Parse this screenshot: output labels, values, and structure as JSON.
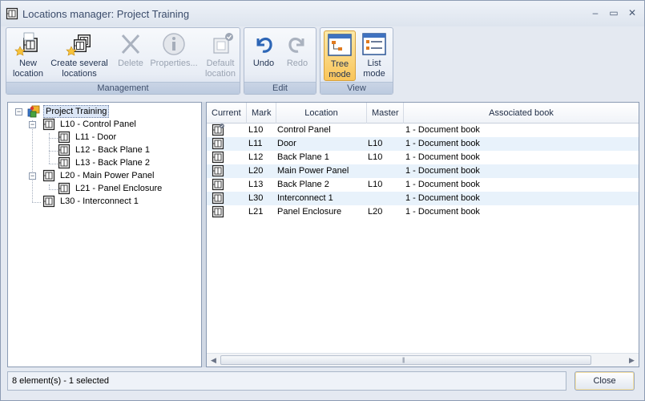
{
  "window": {
    "title": "Locations manager: Project Training",
    "minimize_glyph": "–",
    "maximize_glyph": "▭",
    "close_glyph": "✕"
  },
  "ribbon": {
    "groups": [
      {
        "label": "Management"
      },
      {
        "label": "Edit"
      },
      {
        "label": "View"
      }
    ],
    "buttons": {
      "new_location": {
        "line1": "New",
        "line2": "location",
        "icon": "new-location-icon"
      },
      "create_several": {
        "line1": "Create several",
        "line2": "locations",
        "icon": "create-several-locations-icon"
      },
      "delete": {
        "line1": "Delete",
        "icon": "delete-icon"
      },
      "properties": {
        "line1": "Properties...",
        "icon": "properties-icon"
      },
      "default_location": {
        "line1": "Default",
        "line2": "location",
        "icon": "default-location-icon"
      },
      "undo": {
        "line1": "Undo",
        "icon": "undo-icon"
      },
      "redo": {
        "line1": "Redo",
        "icon": "redo-icon"
      },
      "tree_mode": {
        "line1": "Tree",
        "line2": "mode",
        "icon": "tree-mode-icon"
      },
      "list_mode": {
        "line1": "List",
        "line2": "mode",
        "icon": "list-mode-icon"
      }
    }
  },
  "tree": {
    "root": "Project Training",
    "nodes": [
      {
        "label": "L10 - Control Panel"
      },
      {
        "label": "L11 - Door"
      },
      {
        "label": "L12 - Back Plane 1"
      },
      {
        "label": "L13 - Back Plane 2"
      },
      {
        "label": "L20 - Main Power Panel"
      },
      {
        "label": "L21 - Panel Enclosure"
      },
      {
        "label": "L30 - Interconnect 1"
      }
    ],
    "expander_open": "−"
  },
  "table": {
    "columns": [
      "Current",
      "Mark",
      "Location",
      "Master",
      "Associated book"
    ],
    "rows": [
      {
        "mark": "L10",
        "location": "Control Panel",
        "master": "",
        "book": "1 - Document book"
      },
      {
        "mark": "L11",
        "location": "Door",
        "master": "L10",
        "book": "1 - Document book"
      },
      {
        "mark": "L12",
        "location": "Back Plane 1",
        "master": "L10",
        "book": "1 - Document book"
      },
      {
        "mark": "L20",
        "location": "Main Power Panel",
        "master": "",
        "book": "1 - Document book"
      },
      {
        "mark": "L13",
        "location": "Back Plane 2",
        "master": "L10",
        "book": "1 - Document book"
      },
      {
        "mark": "L30",
        "location": "Interconnect 1",
        "master": "",
        "book": "1 - Document book"
      },
      {
        "mark": "L21",
        "location": "Panel Enclosure",
        "master": "L20",
        "book": "1 - Document book"
      }
    ],
    "scroll_left": "◀",
    "scroll_right": "▶",
    "scroll_grip": "|||"
  },
  "status": {
    "text": "8 element(s) - 1 selected"
  },
  "footer": {
    "close_label": "Close"
  },
  "colors": {
    "accent": "#f9c55a",
    "selection": "#dbe6f6",
    "row_alt": "#e8f2fb"
  }
}
